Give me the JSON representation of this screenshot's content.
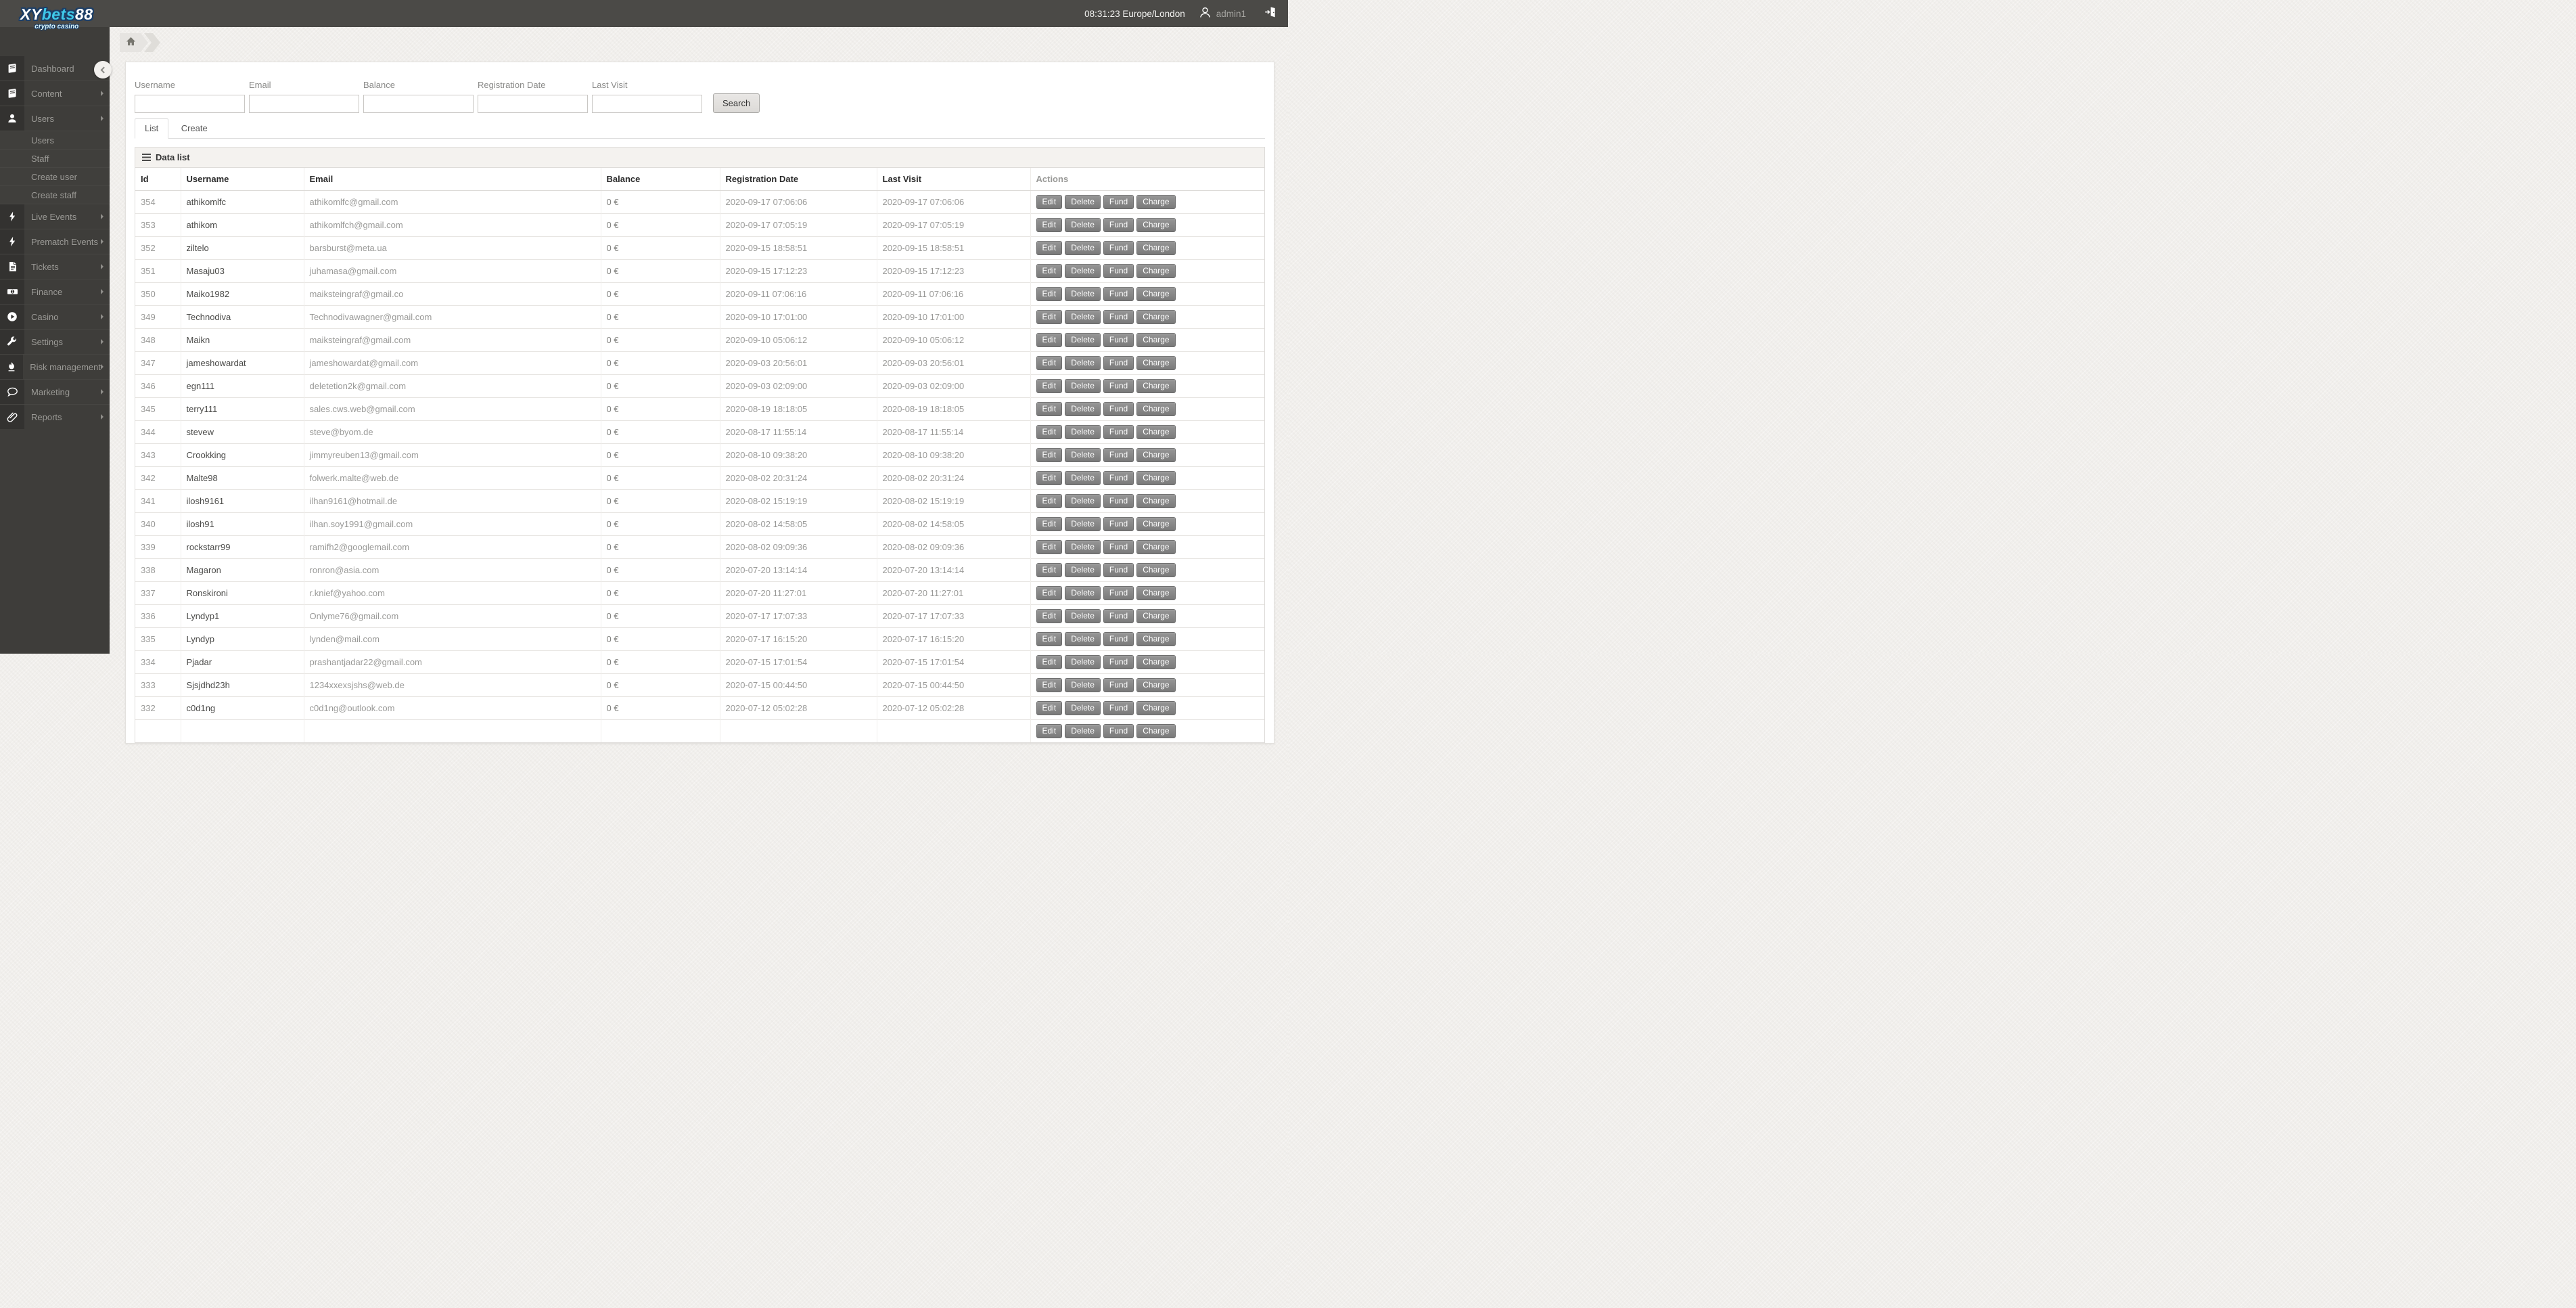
{
  "header": {
    "logo": {
      "part1": "XY",
      "part2": "bets",
      "part3": "88",
      "tagline": "crypto casino"
    },
    "clock": "08:31:23 Europe/London",
    "username": "admin1"
  },
  "sidebar": {
    "items": [
      {
        "label": "Dashboard",
        "icon": "book-icon",
        "has_submenu": true
      },
      {
        "label": "Content",
        "icon": "book-icon",
        "has_submenu": true
      },
      {
        "label": "Users",
        "icon": "user-icon",
        "has_submenu": true,
        "children": [
          "Users",
          "Staff",
          "Create user",
          "Create staff"
        ]
      },
      {
        "label": "Live Events",
        "icon": "bolt-icon",
        "has_submenu": true
      },
      {
        "label": "Prematch Events",
        "icon": "bolt-icon",
        "has_submenu": true
      },
      {
        "label": "Tickets",
        "icon": "document-icon",
        "has_submenu": true
      },
      {
        "label": "Finance",
        "icon": "banknote-icon",
        "has_submenu": true
      },
      {
        "label": "Casino",
        "icon": "play-circle-icon",
        "has_submenu": true
      },
      {
        "label": "Settings",
        "icon": "wrench-icon",
        "has_submenu": true
      },
      {
        "label": "Risk management",
        "icon": "flame-icon",
        "has_submenu": true
      },
      {
        "label": "Marketing",
        "icon": "speech-bubble-icon",
        "has_submenu": true
      },
      {
        "label": "Reports",
        "icon": "paperclip-icon",
        "has_submenu": true
      }
    ]
  },
  "filters": {
    "fields": [
      {
        "label": "Username",
        "value": ""
      },
      {
        "label": "Email",
        "value": ""
      },
      {
        "label": "Balance",
        "value": ""
      },
      {
        "label": "Registration Date",
        "value": ""
      },
      {
        "label": "Last Visit",
        "value": ""
      }
    ],
    "search_label": "Search"
  },
  "tabs": [
    {
      "label": "List",
      "active": true
    },
    {
      "label": "Create",
      "active": false
    }
  ],
  "panel": {
    "title": "Data list"
  },
  "table": {
    "columns": [
      "Id",
      "Username",
      "Email",
      "Balance",
      "Registration Date",
      "Last Visit",
      "Actions"
    ],
    "actions": [
      "Edit",
      "Delete",
      "Fund",
      "Charge"
    ],
    "rows": [
      {
        "id": "354",
        "username": "athikomlfc",
        "email": "athikomlfc@gmail.com",
        "balance": "0 €",
        "registration_date": "2020-09-17 07:06:06",
        "last_visit": "2020-09-17 07:06:06"
      },
      {
        "id": "353",
        "username": "athikom",
        "email": "athikomlfch@gmail.com",
        "balance": "0 €",
        "registration_date": "2020-09-17 07:05:19",
        "last_visit": "2020-09-17 07:05:19"
      },
      {
        "id": "352",
        "username": "ziltelo",
        "email": "barsburst@meta.ua",
        "balance": "0 €",
        "registration_date": "2020-09-15 18:58:51",
        "last_visit": "2020-09-15 18:58:51"
      },
      {
        "id": "351",
        "username": "Masaju03",
        "email": "juhamasa@gmail.com",
        "balance": "0 €",
        "registration_date": "2020-09-15 17:12:23",
        "last_visit": "2020-09-15 17:12:23"
      },
      {
        "id": "350",
        "username": "Maiko1982",
        "email": "maiksteingraf@gmail.co",
        "balance": "0 €",
        "registration_date": "2020-09-11 07:06:16",
        "last_visit": "2020-09-11 07:06:16"
      },
      {
        "id": "349",
        "username": "Technodiva",
        "email": "Technodivawagner@gmail.com",
        "balance": "0 €",
        "registration_date": "2020-09-10 17:01:00",
        "last_visit": "2020-09-10 17:01:00"
      },
      {
        "id": "348",
        "username": "Maikn",
        "email": "maiksteingraf@gmail.com",
        "balance": "0 €",
        "registration_date": "2020-09-10 05:06:12",
        "last_visit": "2020-09-10 05:06:12"
      },
      {
        "id": "347",
        "username": "jameshowardat",
        "email": "jameshowardat@gmail.com",
        "balance": "0 €",
        "registration_date": "2020-09-03 20:56:01",
        "last_visit": "2020-09-03 20:56:01"
      },
      {
        "id": "346",
        "username": "egn111",
        "email": "deletetion2k@gmail.com",
        "balance": "0 €",
        "registration_date": "2020-09-03 02:09:00",
        "last_visit": "2020-09-03 02:09:00"
      },
      {
        "id": "345",
        "username": "terry111",
        "email": "sales.cws.web@gmail.com",
        "balance": "0 €",
        "registration_date": "2020-08-19 18:18:05",
        "last_visit": "2020-08-19 18:18:05"
      },
      {
        "id": "344",
        "username": "stevew",
        "email": "steve@byom.de",
        "balance": "0 €",
        "registration_date": "2020-08-17 11:55:14",
        "last_visit": "2020-08-17 11:55:14"
      },
      {
        "id": "343",
        "username": "Crookking",
        "email": "jimmyreuben13@gmail.com",
        "balance": "0 €",
        "registration_date": "2020-08-10 09:38:20",
        "last_visit": "2020-08-10 09:38:20"
      },
      {
        "id": "342",
        "username": "Malte98",
        "email": "folwerk.malte@web.de",
        "balance": "0 €",
        "registration_date": "2020-08-02 20:31:24",
        "last_visit": "2020-08-02 20:31:24"
      },
      {
        "id": "341",
        "username": "ilosh9161",
        "email": "ilhan9161@hotmail.de",
        "balance": "0 €",
        "registration_date": "2020-08-02 15:19:19",
        "last_visit": "2020-08-02 15:19:19"
      },
      {
        "id": "340",
        "username": "ilosh91",
        "email": "ilhan.soy1991@gmail.com",
        "balance": "0 €",
        "registration_date": "2020-08-02 14:58:05",
        "last_visit": "2020-08-02 14:58:05"
      },
      {
        "id": "339",
        "username": "rockstarr99",
        "email": "ramifh2@googlemail.com",
        "balance": "0 €",
        "registration_date": "2020-08-02 09:09:36",
        "last_visit": "2020-08-02 09:09:36"
      },
      {
        "id": "338",
        "username": "Magaron",
        "email": "ronron@asia.com",
        "balance": "0 €",
        "registration_date": "2020-07-20 13:14:14",
        "last_visit": "2020-07-20 13:14:14"
      },
      {
        "id": "337",
        "username": "Ronskironi",
        "email": "r.knief@yahoo.com",
        "balance": "0 €",
        "registration_date": "2020-07-20 11:27:01",
        "last_visit": "2020-07-20 11:27:01"
      },
      {
        "id": "336",
        "username": "Lyndyp1",
        "email": "Onlyme76@gmail.com",
        "balance": "0 €",
        "registration_date": "2020-07-17 17:07:33",
        "last_visit": "2020-07-17 17:07:33"
      },
      {
        "id": "335",
        "username": "Lyndyp",
        "email": "lynden@mail.com",
        "balance": "0 €",
        "registration_date": "2020-07-17 16:15:20",
        "last_visit": "2020-07-17 16:15:20"
      },
      {
        "id": "334",
        "username": "Pjadar",
        "email": "prashantjadar22@gmail.com",
        "balance": "0 €",
        "registration_date": "2020-07-15 17:01:54",
        "last_visit": "2020-07-15 17:01:54"
      },
      {
        "id": "333",
        "username": "Sjsjdhd23h",
        "email": "1234xxexsjshs@web.de",
        "balance": "0 €",
        "registration_date": "2020-07-15 00:44:50",
        "last_visit": "2020-07-15 00:44:50"
      },
      {
        "id": "332",
        "username": "c0d1ng",
        "email": "c0d1ng@outlook.com",
        "balance": "0 €",
        "registration_date": "2020-07-12 05:02:28",
        "last_visit": "2020-07-12 05:02:28"
      }
    ]
  },
  "colors": {
    "topbar": "#4b4a47",
    "sidebar": "#3e3d3a",
    "logo_cyan": "#3fc8e9",
    "action_button": "#858585",
    "panel_header": "#f4f2ef"
  }
}
